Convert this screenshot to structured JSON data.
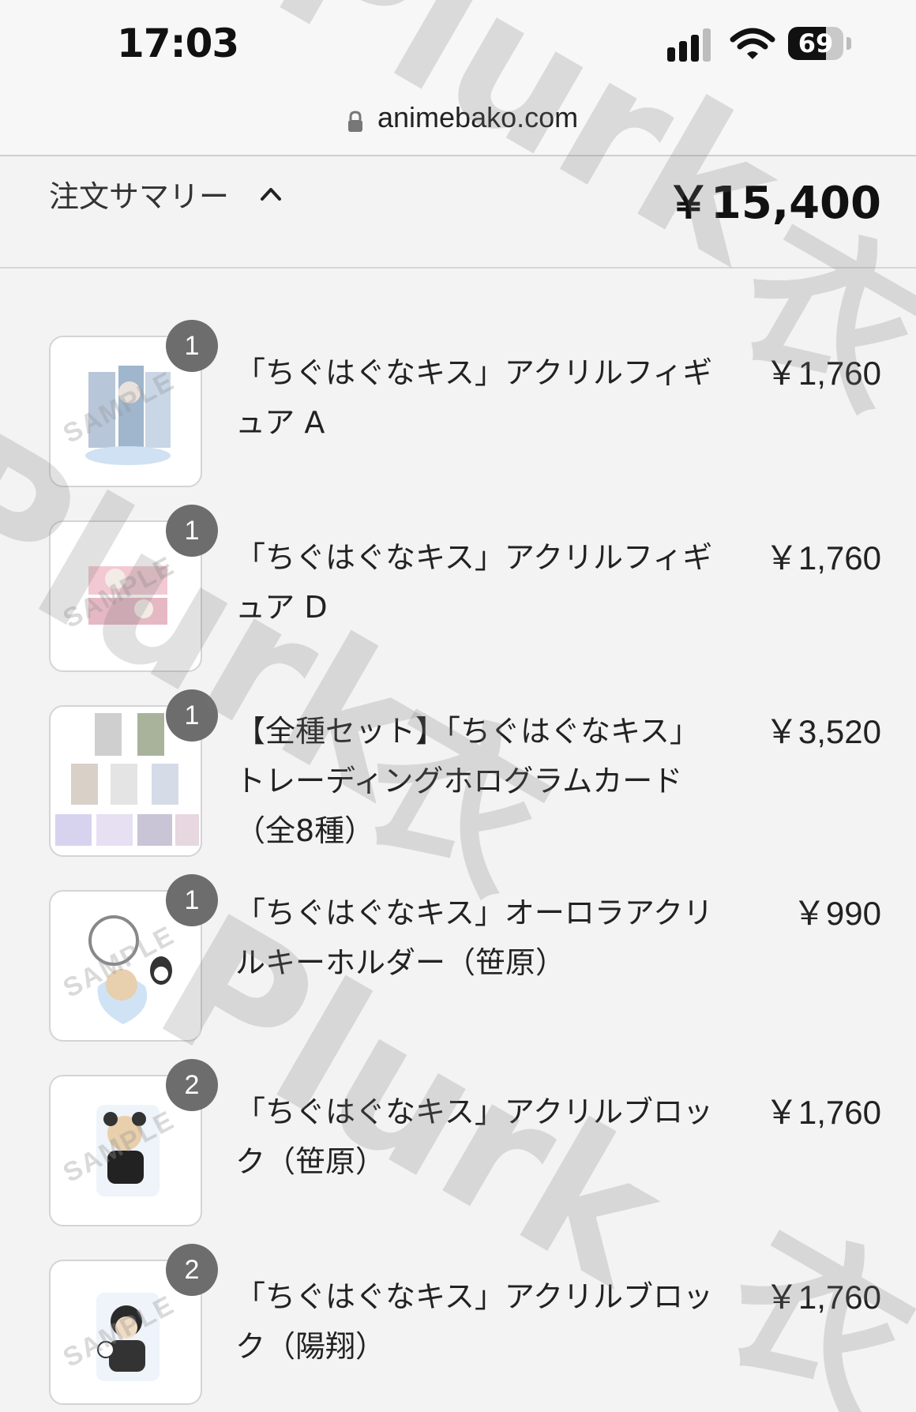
{
  "status_bar": {
    "time": "17:03",
    "battery": "69",
    "battery_level": 0.69
  },
  "url_bar": {
    "domain": "animebako.com"
  },
  "summary": {
    "label": "注文サマリー",
    "total": "￥15,400"
  },
  "items": [
    {
      "qty": "1",
      "name": "「ちぐはぐなキス」アクリルフィギュア A",
      "price": "￥1,760"
    },
    {
      "qty": "1",
      "name": "「ちぐはぐなキス」アクリルフィギュア D",
      "price": "￥1,760"
    },
    {
      "qty": "1",
      "name": "【全種セット】「ちぐはぐなキス」トレーディングホログラムカード（全8種）",
      "price": "￥3,520"
    },
    {
      "qty": "1",
      "name": "「ちぐはぐなキス」オーロラアクリルキーホルダー（笹原）",
      "price": "￥990"
    },
    {
      "qty": "2",
      "name": "「ちぐはぐなキス」アクリルブロック（笹原）",
      "price": "￥1,760"
    },
    {
      "qty": "2",
      "name": "「ちぐはぐなキス」アクリルブロック（陽翔）",
      "price": "￥1,760"
    }
  ],
  "thumbnail_mark": "SAMPLE",
  "watermark": {
    "text_latin": "Plurk",
    "text_cjk": "衣"
  }
}
